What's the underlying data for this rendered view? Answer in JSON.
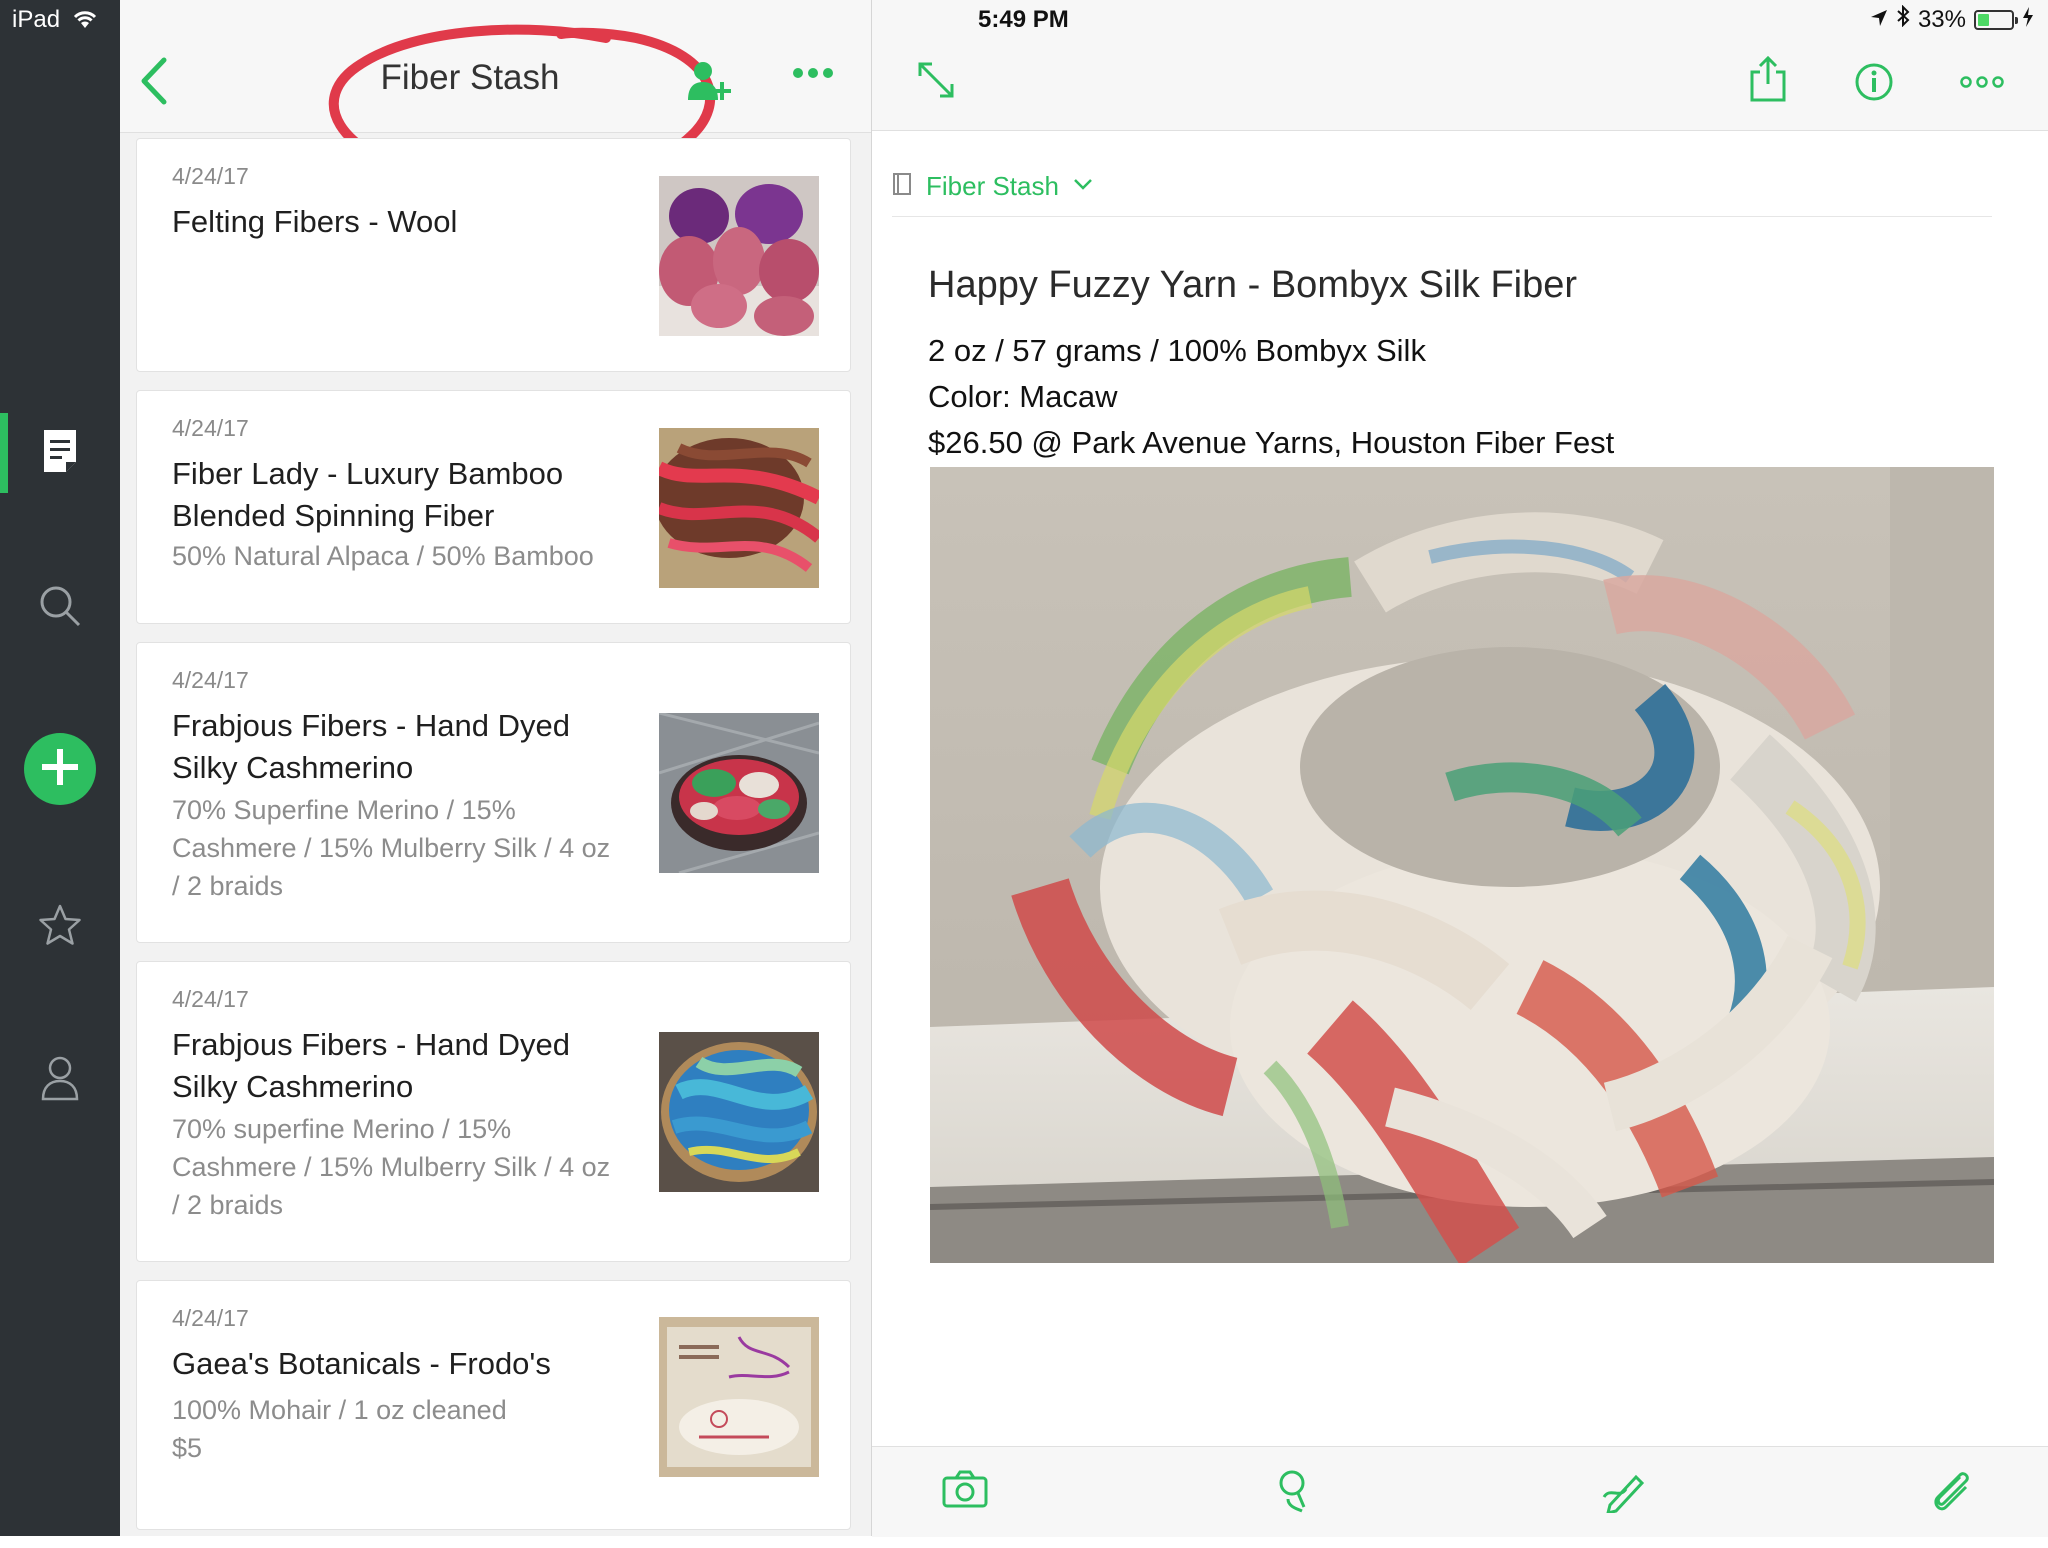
{
  "status_bar": {
    "device": "iPad",
    "time": "5:49 PM",
    "battery_percent": "33%"
  },
  "sidebar": {
    "items": [
      {
        "name": "notes",
        "icon": "note-icon",
        "active": true
      },
      {
        "name": "search",
        "icon": "search-icon"
      },
      {
        "name": "new-note",
        "icon": "plus-icon"
      },
      {
        "name": "shortcuts",
        "icon": "star-icon"
      },
      {
        "name": "account",
        "icon": "user-icon"
      }
    ]
  },
  "note_list": {
    "title": "Fiber Stash",
    "notes": [
      {
        "date": "4/24/17",
        "title": "Felting Fibers - Wool",
        "snippet": ""
      },
      {
        "date": "4/24/17",
        "title": "Fiber Lady - Luxury Bamboo Blended Spinning Fiber",
        "snippet": "50% Natural Alpaca / 50% Bamboo"
      },
      {
        "date": "4/24/17",
        "title": "Frabjous Fibers - Hand Dyed Silky Cashmerino",
        "snippet": "70% Superfine Merino / 15% Cashmere / 15% Mulberry Silk / 4 oz / 2 braids"
      },
      {
        "date": "4/24/17",
        "title": "Frabjous Fibers - Hand Dyed Silky Cashmerino",
        "snippet": "70% superfine Merino / 15% Cashmere / 15% Mulberry Silk / 4 oz / 2 braids"
      },
      {
        "date": "4/24/17",
        "title": "Gaea's Botanicals - Frodo's",
        "snippet": "100% Mohair / 1 oz cleaned $5"
      }
    ]
  },
  "note": {
    "notebook": "Fiber Stash",
    "title": "Happy Fuzzy Yarn - Bombyx Silk Fiber",
    "lines": [
      "2 oz / 57 grams / 100% Bombyx Silk",
      "Color: Macaw",
      "$26.50 @ Park Avenue Yarns, Houston Fiber Fest"
    ]
  },
  "bottom_toolbar": [
    "camera-icon",
    "microphone-icon",
    "handwriting-icon",
    "attachment-icon"
  ],
  "colors": {
    "accent": "#2dbe60",
    "sidebar": "#2d3236",
    "annotation": "#e03a4a"
  }
}
